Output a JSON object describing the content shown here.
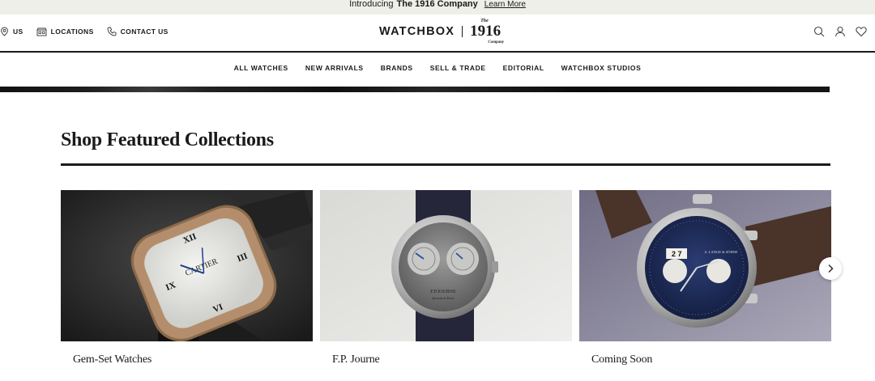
{
  "announcement": {
    "prefix": "Introducing",
    "brand": "The 1916 Company",
    "link": "Learn More"
  },
  "header": {
    "utility": [
      {
        "label": "US",
        "icon": "location-pin-icon"
      },
      {
        "label": "LOCATIONS",
        "icon": "store-icon"
      },
      {
        "label": "CONTACT US",
        "icon": "phone-icon"
      }
    ],
    "logo": {
      "watchbox": "WATCHBOX",
      "the": "The",
      "number": "1916",
      "company": "Company"
    }
  },
  "nav": [
    "ALL WATCHES",
    "NEW ARRIVALS",
    "BRANDS",
    "SELL & TRADE",
    "EDITORIAL",
    "WATCHBOX STUDIOS"
  ],
  "featured": {
    "title": "Shop Featured Collections",
    "cards": [
      {
        "label": "Gem-Set Watches",
        "image": "cartier-gem-set-watch"
      },
      {
        "label": "F.P. Journe",
        "image": "fp-journe-watch"
      },
      {
        "label": "Coming Soon",
        "image": "lange-datograph-watch"
      }
    ]
  },
  "colors": {
    "announce_bg": "#efefe9",
    "text": "#1a1a1a"
  }
}
